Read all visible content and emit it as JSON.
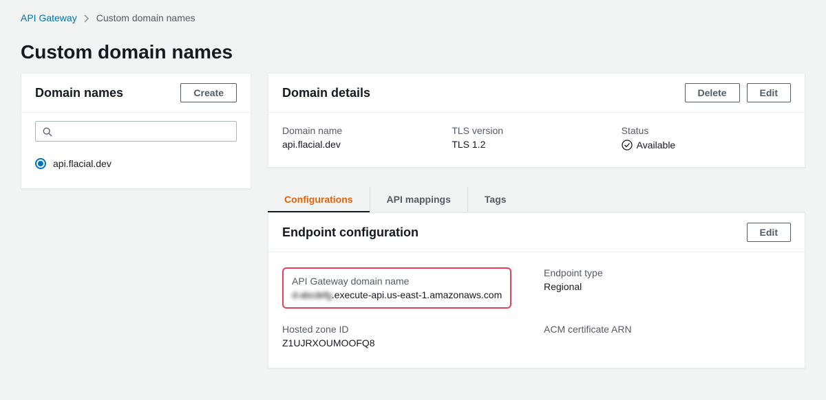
{
  "breadcrumb": {
    "root": "API Gateway",
    "current": "Custom domain names"
  },
  "page_title": "Custom domain names",
  "sidebar": {
    "title": "Domain names",
    "create_label": "Create",
    "search_placeholder": "",
    "items": [
      {
        "label": "api.flacial.dev",
        "selected": true
      }
    ]
  },
  "details": {
    "title": "Domain details",
    "delete_label": "Delete",
    "edit_label": "Edit",
    "fields": {
      "domain_name_label": "Domain name",
      "domain_name_value": "api.flacial.dev",
      "tls_label": "TLS version",
      "tls_value": "TLS 1.2",
      "status_label": "Status",
      "status_value": "Available"
    }
  },
  "tabs": {
    "configurations": "Configurations",
    "api_mappings": "API mappings",
    "tags": "Tags"
  },
  "endpoint": {
    "title": "Endpoint configuration",
    "edit_label": "Edit",
    "api_domain_label": "API Gateway domain name",
    "api_domain_prefix_redacted": "d-abcdefg",
    "api_domain_suffix": ".execute-api.us-east-1.amazonaws.com",
    "endpoint_type_label": "Endpoint type",
    "endpoint_type_value": "Regional",
    "hosted_zone_label": "Hosted zone ID",
    "hosted_zone_value": "Z1UJRXOUMOOFQ8",
    "acm_label": "ACM certificate ARN"
  }
}
